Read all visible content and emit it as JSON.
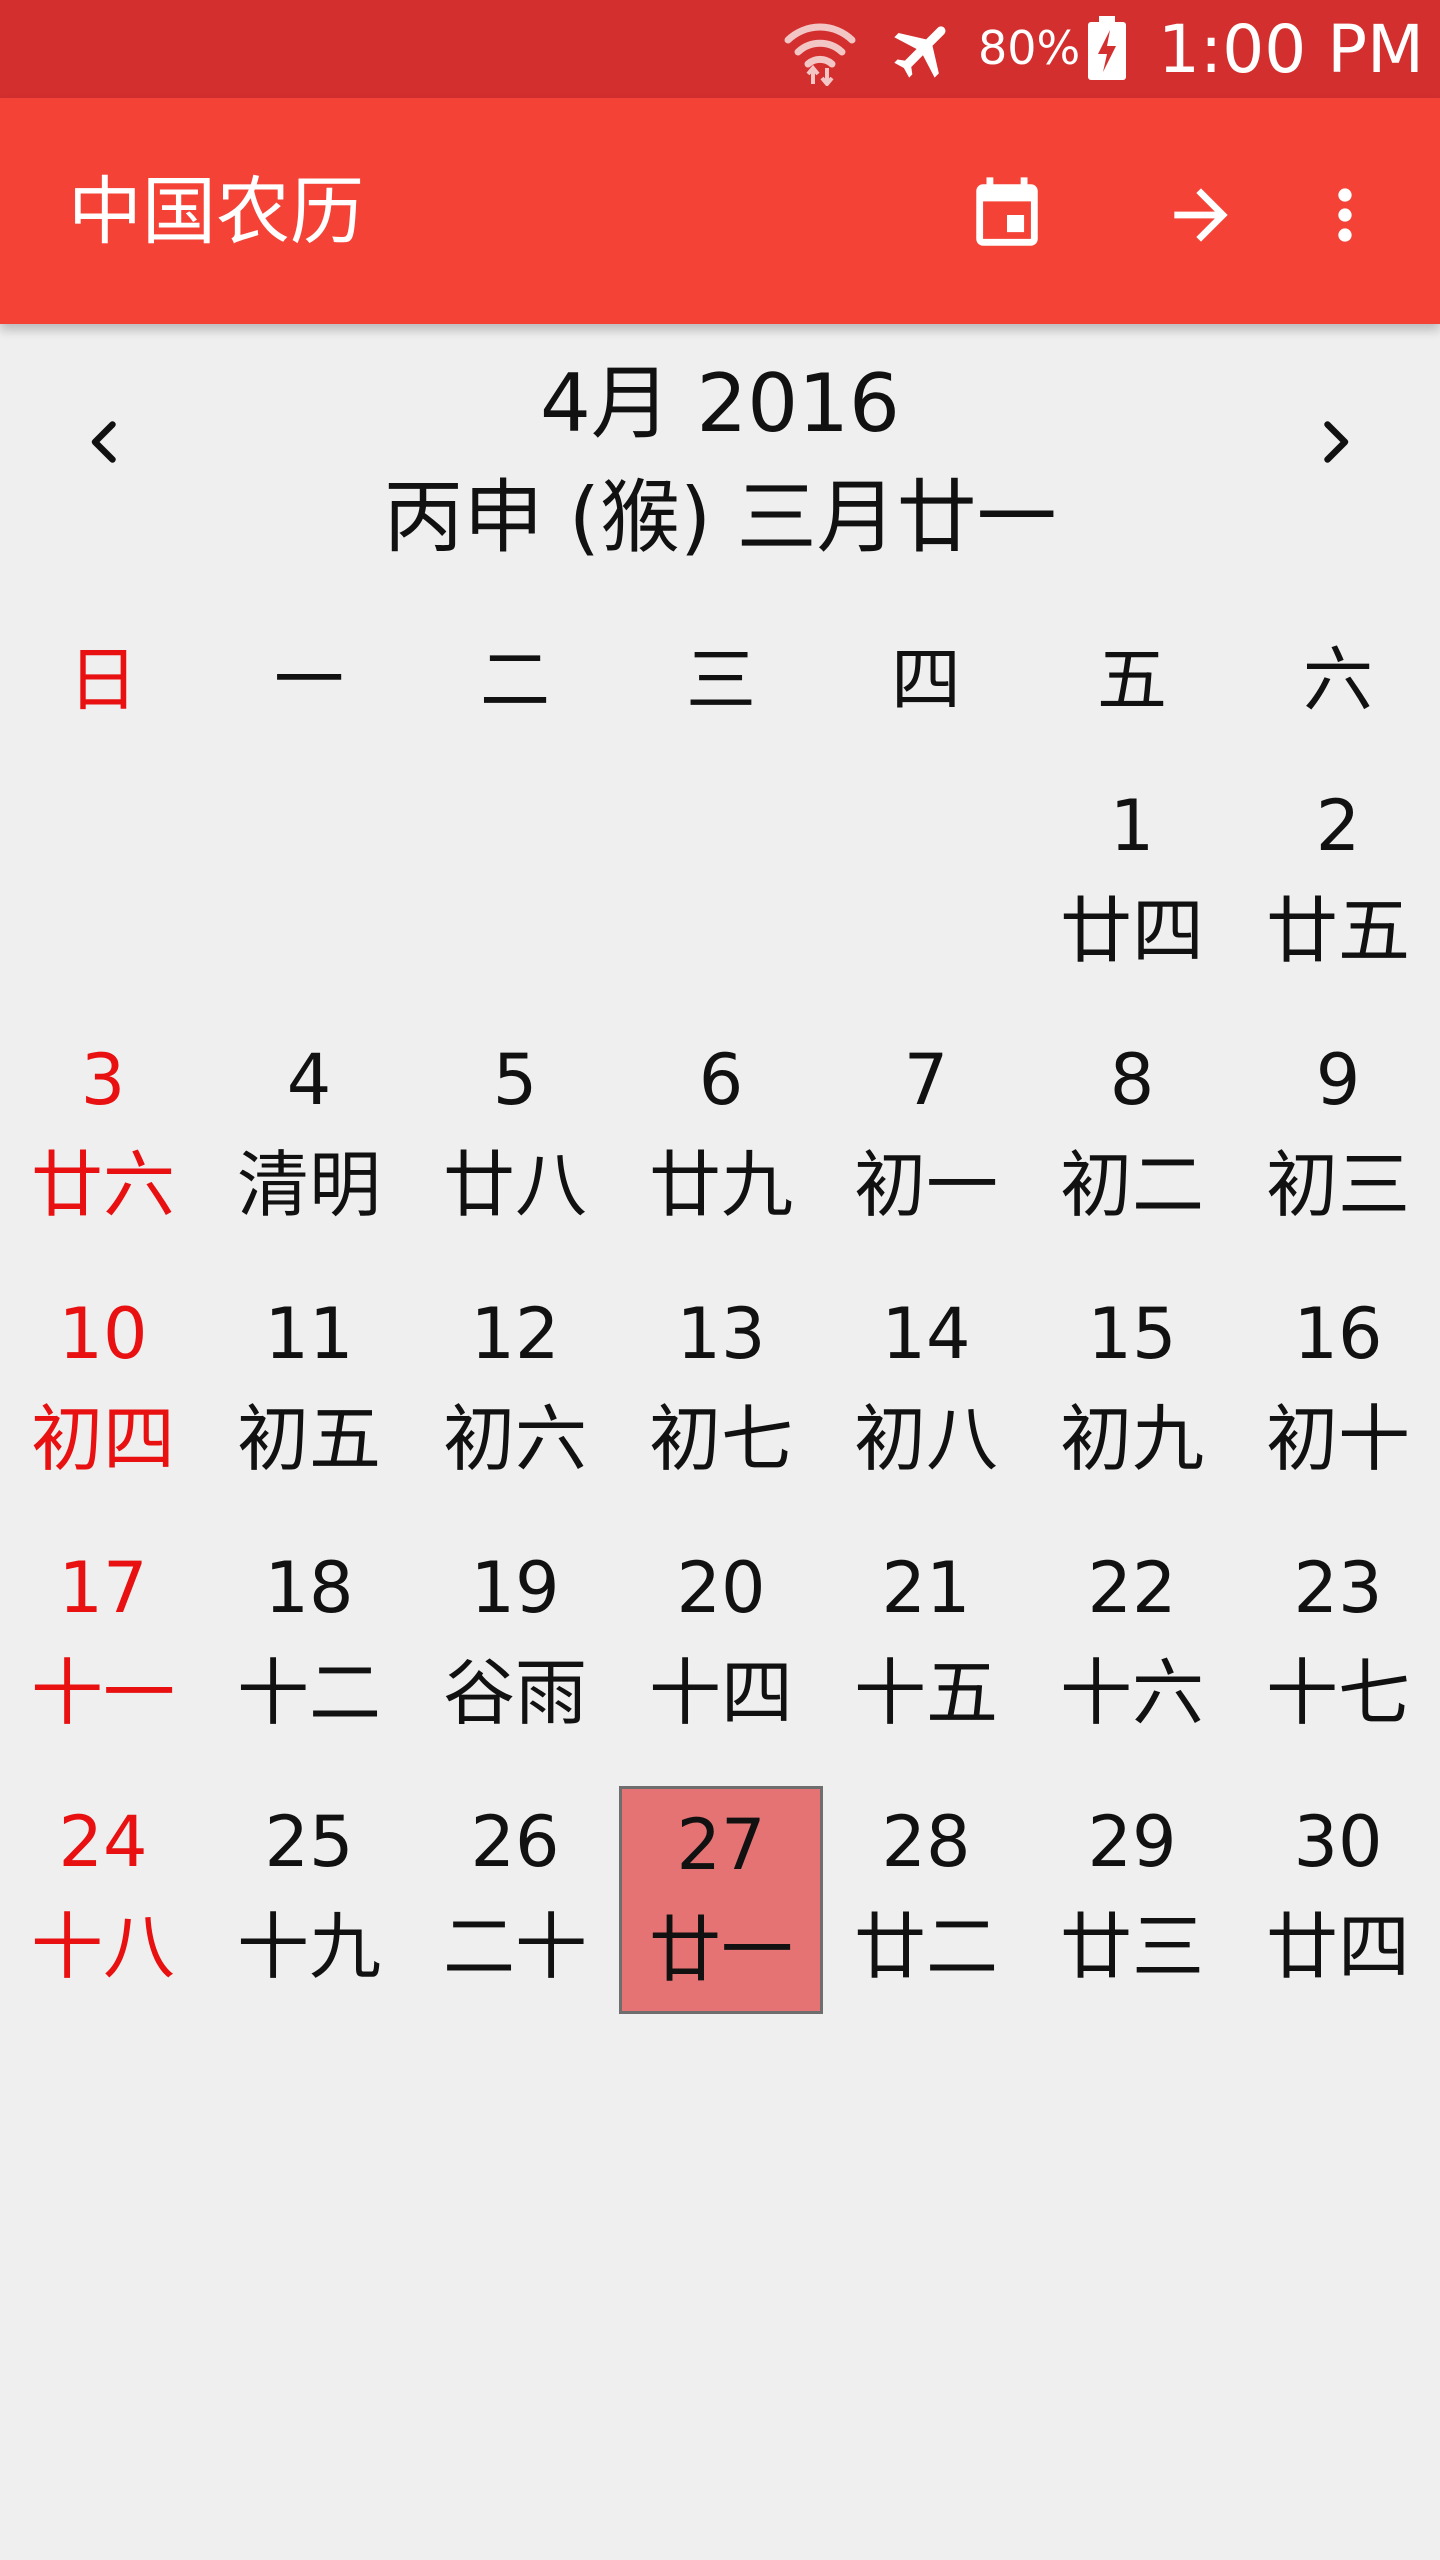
{
  "status_bar": {
    "battery_percent": "80%",
    "time": "1:00 PM",
    "icons": [
      "wifi-icon",
      "airplane-mode-icon",
      "battery-charging-icon"
    ]
  },
  "app_bar": {
    "title": "中国农历",
    "actions": [
      "calendar-today-icon",
      "arrow-forward-icon",
      "more-vert-icon"
    ]
  },
  "header": {
    "month_title": "4月 2016",
    "lunar_title": "丙申 (猴) 三月廿一"
  },
  "weekdays": [
    "日",
    "一",
    "二",
    "三",
    "四",
    "五",
    "六"
  ],
  "calendar": {
    "first_weekday_index": 5,
    "today": "27",
    "days": [
      {
        "g": "1",
        "l": "廿四"
      },
      {
        "g": "2",
        "l": "廿五"
      },
      {
        "g": "3",
        "l": "廿六"
      },
      {
        "g": "4",
        "l": "清明"
      },
      {
        "g": "5",
        "l": "廿八"
      },
      {
        "g": "6",
        "l": "廿九"
      },
      {
        "g": "7",
        "l": "初一"
      },
      {
        "g": "8",
        "l": "初二"
      },
      {
        "g": "9",
        "l": "初三"
      },
      {
        "g": "10",
        "l": "初四"
      },
      {
        "g": "11",
        "l": "初五"
      },
      {
        "g": "12",
        "l": "初六"
      },
      {
        "g": "13",
        "l": "初七"
      },
      {
        "g": "14",
        "l": "初八"
      },
      {
        "g": "15",
        "l": "初九"
      },
      {
        "g": "16",
        "l": "初十"
      },
      {
        "g": "17",
        "l": "十一"
      },
      {
        "g": "18",
        "l": "十二"
      },
      {
        "g": "19",
        "l": "谷雨"
      },
      {
        "g": "20",
        "l": "十四"
      },
      {
        "g": "21",
        "l": "十五"
      },
      {
        "g": "22",
        "l": "十六"
      },
      {
        "g": "23",
        "l": "十七"
      },
      {
        "g": "24",
        "l": "十八"
      },
      {
        "g": "25",
        "l": "十九"
      },
      {
        "g": "26",
        "l": "二十"
      },
      {
        "g": "27",
        "l": "廿一"
      },
      {
        "g": "28",
        "l": "廿二"
      },
      {
        "g": "29",
        "l": "廿三"
      },
      {
        "g": "30",
        "l": "廿四"
      }
    ]
  },
  "colors": {
    "status_bar": "#d32f2f",
    "app_bar": "#f44336",
    "sunday_text": "#e81010",
    "today_highlight": "#e57373",
    "background": "#efefef"
  }
}
